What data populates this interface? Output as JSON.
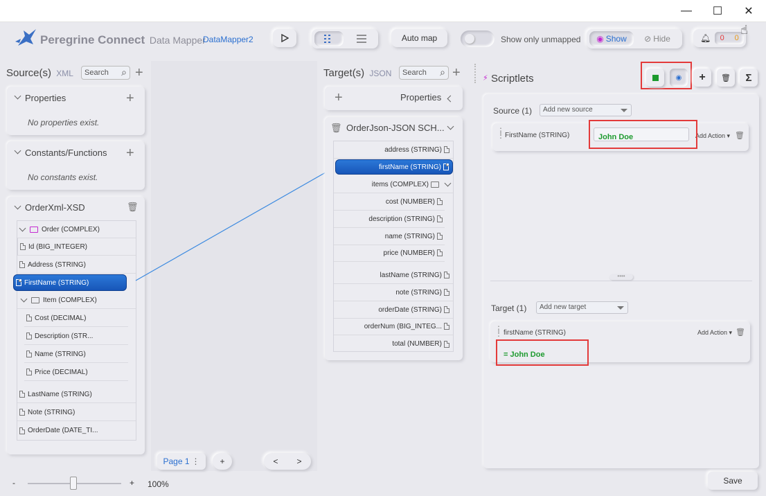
{
  "window": {
    "minimize": "—",
    "maximize": "☐",
    "close": "✕"
  },
  "toolbar": {
    "brand": "Peregrine Connect",
    "product": "Data Mapper",
    "map_name": "DataMapper2",
    "run_icon": "play-icon",
    "auto_map": "Auto map",
    "show_only_unmapped": "Show only unmapped",
    "show": "Show",
    "hide": "Hide",
    "errors_count": "0",
    "warnings_count": "0"
  },
  "source": {
    "title": "Source(s)",
    "format": "XML",
    "search_placeholder": "Search",
    "properties": {
      "title": "Properties",
      "empty": "No properties exist."
    },
    "constants": {
      "title": "Constants/Functions",
      "empty": "No constants exist."
    },
    "doc": {
      "title": "OrderXml-XSD",
      "nodes": [
        "Order (COMPLEX)",
        "Id (BIG_INTEGER)",
        "Address (STRING)",
        "FirstName (STRING)",
        "Item (COMPLEX)",
        "Cost (DECIMAL)",
        "Description (STR...",
        "Name (STRING)",
        "Price (DECIMAL)",
        "LastName (STRING)",
        "Note (STRING)",
        "OrderDate (DATE_TI..."
      ]
    }
  },
  "target": {
    "title": "Target(s)",
    "format": "JSON",
    "search_placeholder": "Search",
    "properties_title": "Properties",
    "doc": {
      "title": "OrderJson-JSON SCH...",
      "nodes": [
        "address (STRING)",
        "firstName (STRING)",
        "items (COMPLEX)",
        "cost (NUMBER)",
        "description (STRING)",
        "name (STRING)",
        "price (NUMBER)",
        "lastName (STRING)",
        "note (STRING)",
        "orderDate (STRING)",
        "orderNum (BIG_INTEG...",
        "total (NUMBER)"
      ]
    }
  },
  "pager": {
    "page": "Page 1",
    "add": "+",
    "prev": "<",
    "next": ">"
  },
  "scriptlets": {
    "title": "Scriptlets",
    "source_label": "Source (1)",
    "add_source": "Add new source",
    "source_field": "FirstName (STRING)",
    "source_value": "John Doe",
    "add_action": "Add Action",
    "target_label": "Target (1)",
    "add_target": "Add new target",
    "target_field": "firstName (STRING)",
    "target_value": "= John Doe",
    "add_action_2": "Add Action",
    "sigma": "Σ",
    "plus": "+"
  },
  "statusbar": {
    "zoom_minus": "-",
    "zoom_plus": "+",
    "zoom": "100%",
    "save": "Save"
  },
  "colors": {
    "accent": "#1f63c8",
    "mapping_line": "#3c8ae0",
    "highlight": "#e33a3a",
    "value_green": "#1d9a2e"
  }
}
